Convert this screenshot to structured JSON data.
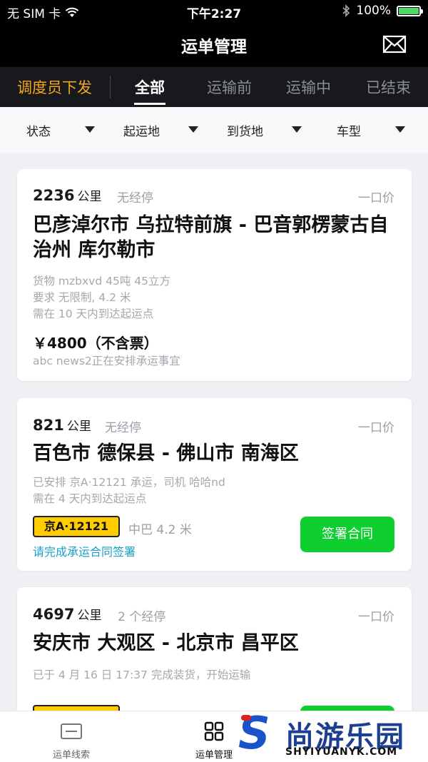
{
  "status_bar": {
    "carrier": "无 SIM 卡",
    "time": "下午2:27",
    "battery": "100%",
    "battery_level": 1.0
  },
  "nav": {
    "title": "运单管理",
    "mail_icon": "mail-icon"
  },
  "tabs": {
    "dispatch": "调度员下发",
    "items": [
      "全部",
      "运输前",
      "运输中",
      "已结束"
    ],
    "active": "全部"
  },
  "filters": [
    "状态",
    "起运地",
    "到货地",
    "车型"
  ],
  "cards": [
    {
      "distance": "2236",
      "unit": "公里",
      "stops": "无经停",
      "price_type": "一口价",
      "route": "巴彦淖尔市 乌拉特前旗 - 巴音郭楞蒙古自治州 库尔勒市",
      "cargo": "货物 mzbxvd 45吨 45立方",
      "requirement": "要求 无限制, 4.2 米",
      "deadline": "需在 10 天内到达起运点",
      "price": "￥4800（不含票）",
      "note": "abc news2正在安排承运事宜"
    },
    {
      "distance": "821",
      "unit": "公里",
      "stops": "无经停",
      "price_type": "一口价",
      "route": "百色市 德保县 - 佛山市 南海区",
      "arranged": "已安排 京A·12121 承运，司机 哈哈nd",
      "deadline": "需在 4 天内到达起运点",
      "plate": "京A·12121",
      "vehicle": "中巴 4.2 米",
      "contract_link": "请完成承运合同签署",
      "sign_button": "签署合同"
    },
    {
      "distance": "4697",
      "unit": "公里",
      "stops": "2 个经停",
      "price_type": "一口价",
      "route": "安庆市 大观区 - 北京市 昌平区",
      "loaded": "已于 4 月 16 日 17:37 完成装货，开始运输"
    }
  ],
  "bottom_tabs": [
    {
      "label": "运单线索",
      "icon": "card-icon"
    },
    {
      "label": "运单管理",
      "icon": "grid-icon"
    }
  ],
  "watermark": {
    "brand": "尚游乐园",
    "url": "SHYIYUANYK.COM"
  },
  "colors": {
    "accent_orange": "#f5a623",
    "green_button": "#0fce2f",
    "plate_yellow": "#ffcc00",
    "link_blue": "#1aa0c9"
  }
}
